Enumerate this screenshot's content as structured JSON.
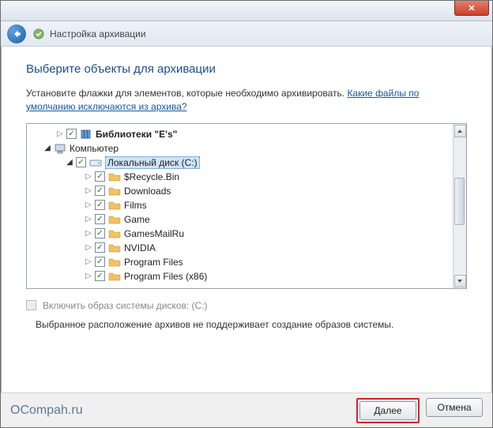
{
  "window": {
    "close_glyph": "✕"
  },
  "nav": {
    "title": "Настройка архивации"
  },
  "wizard": {
    "heading": "Выберите объекты для архивации",
    "description": "Установите флажки для элементов, которые необходимо архивировать. ",
    "link_text": "Какие файлы по умолчанию исключаются из архива?"
  },
  "tree": {
    "libraries": "Библиотеки \"E's\"",
    "computer": "Компьютер",
    "local_disk": "Локальный диск (C:)",
    "items": [
      "$Recycle.Bin",
      "Downloads",
      "Films",
      "Game",
      "GamesMailRu",
      "NVIDIA",
      "Program Files",
      "Program Files (x86)"
    ]
  },
  "options": {
    "system_image_label": "Включить образ системы дисков: (C:)",
    "note": "Выбранное расположение архивов не поддерживает создание образов системы."
  },
  "footer": {
    "watermark": "OCompah.ru",
    "next": "Далее",
    "cancel": "Отмена"
  }
}
